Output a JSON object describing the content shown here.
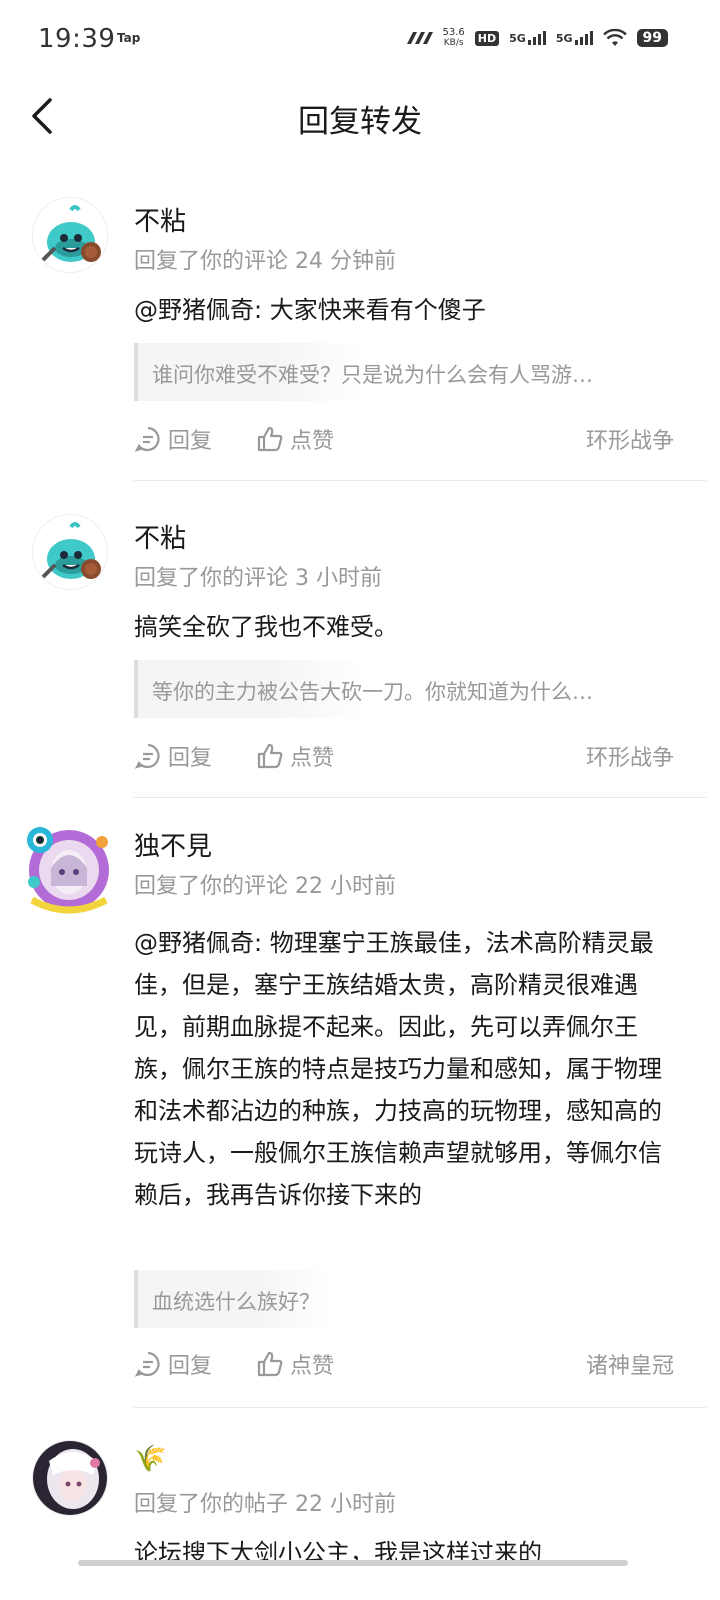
{
  "status_bar": {
    "time": "19:39",
    "app": "Tap",
    "net_speed_value": "53.6",
    "net_speed_unit": "KB/s",
    "hd": "HD",
    "sim1": "5G",
    "sim2": "5G",
    "battery": "99"
  },
  "header": {
    "title": "回复转发",
    "back_icon": "chevron-left-icon"
  },
  "items": [
    {
      "username": "不粘",
      "meta": "回复了你的评论 24 分钟前",
      "content": "@野猪佩奇: 大家快来看有个傻子",
      "quote": "谁问你难受不难受？只是说为什么会有人骂游…",
      "reply_label": "回复",
      "like_label": "点赞",
      "game": "环形战争",
      "avatar": "slime-avatar"
    },
    {
      "username": "不粘",
      "meta": "回复了你的评论 3 小时前",
      "content": "搞笑全砍了我也不难受。",
      "quote": "等你的主力被公告大砍一刀。你就知道为什么…",
      "reply_label": "回复",
      "like_label": "点赞",
      "game": "环形战争",
      "avatar": "slime-avatar"
    },
    {
      "username": "独不見",
      "meta": "回复了你的评论 22 小时前",
      "content": "@野猪佩奇: 物理塞宁王族最佳，法术高阶精灵最佳，但是，塞宁王族结婚太贵，高阶精灵很难遇见，前期血脉提不起来。因此，先可以弄佩尔王族，佩尔王族的特点是技巧力量和感知，属于物理和法术都沾边的种族，力技高的玩物理，感知高的玩诗人，一般佩尔王族信赖声望就够用，等佩尔信赖后，我再告诉你接下来的",
      "quote": "血统选什么族好？",
      "reply_label": "回复",
      "like_label": "点赞",
      "game": "诸神皇冠",
      "avatar": "anime-girl-avatar"
    },
    {
      "username": "🌾",
      "meta": "回复了你的帖子 22 小时前",
      "content": "论坛搜下大剑小公主，我是这样过来的",
      "avatar": "white-hair-girl-avatar"
    }
  ]
}
